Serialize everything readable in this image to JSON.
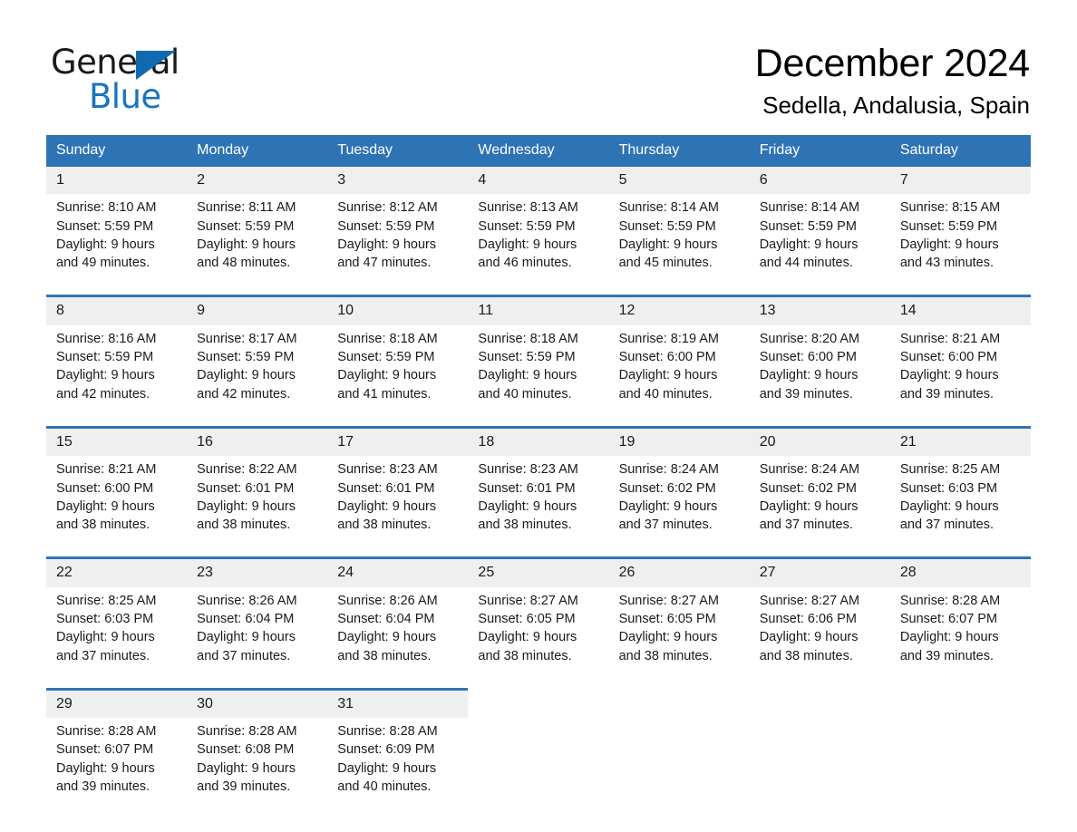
{
  "brand": {
    "name_part1": "General",
    "name_part2": "Blue",
    "triangle_color": "#1169b0",
    "blue_color": "#1a75bb"
  },
  "header": {
    "title": "December 2024",
    "location": "Sedella, Andalusia, Spain"
  },
  "theme": {
    "header_blue": "#2e74b5",
    "daynum_band": "#efefef",
    "text": "#1a1a1a"
  },
  "weekdays": [
    "Sunday",
    "Monday",
    "Tuesday",
    "Wednesday",
    "Thursday",
    "Friday",
    "Saturday"
  ],
  "weeks": [
    {
      "days": [
        {
          "date": "1",
          "sunrise": "Sunrise: 8:10 AM",
          "sunset": "Sunset: 5:59 PM",
          "daylight1": "Daylight: 9 hours",
          "daylight2": "and 49 minutes."
        },
        {
          "date": "2",
          "sunrise": "Sunrise: 8:11 AM",
          "sunset": "Sunset: 5:59 PM",
          "daylight1": "Daylight: 9 hours",
          "daylight2": "and 48 minutes."
        },
        {
          "date": "3",
          "sunrise": "Sunrise: 8:12 AM",
          "sunset": "Sunset: 5:59 PM",
          "daylight1": "Daylight: 9 hours",
          "daylight2": "and 47 minutes."
        },
        {
          "date": "4",
          "sunrise": "Sunrise: 8:13 AM",
          "sunset": "Sunset: 5:59 PM",
          "daylight1": "Daylight: 9 hours",
          "daylight2": "and 46 minutes."
        },
        {
          "date": "5",
          "sunrise": "Sunrise: 8:14 AM",
          "sunset": "Sunset: 5:59 PM",
          "daylight1": "Daylight: 9 hours",
          "daylight2": "and 45 minutes."
        },
        {
          "date": "6",
          "sunrise": "Sunrise: 8:14 AM",
          "sunset": "Sunset: 5:59 PM",
          "daylight1": "Daylight: 9 hours",
          "daylight2": "and 44 minutes."
        },
        {
          "date": "7",
          "sunrise": "Sunrise: 8:15 AM",
          "sunset": "Sunset: 5:59 PM",
          "daylight1": "Daylight: 9 hours",
          "daylight2": "and 43 minutes."
        }
      ]
    },
    {
      "days": [
        {
          "date": "8",
          "sunrise": "Sunrise: 8:16 AM",
          "sunset": "Sunset: 5:59 PM",
          "daylight1": "Daylight: 9 hours",
          "daylight2": "and 42 minutes."
        },
        {
          "date": "9",
          "sunrise": "Sunrise: 8:17 AM",
          "sunset": "Sunset: 5:59 PM",
          "daylight1": "Daylight: 9 hours",
          "daylight2": "and 42 minutes."
        },
        {
          "date": "10",
          "sunrise": "Sunrise: 8:18 AM",
          "sunset": "Sunset: 5:59 PM",
          "daylight1": "Daylight: 9 hours",
          "daylight2": "and 41 minutes."
        },
        {
          "date": "11",
          "sunrise": "Sunrise: 8:18 AM",
          "sunset": "Sunset: 5:59 PM",
          "daylight1": "Daylight: 9 hours",
          "daylight2": "and 40 minutes."
        },
        {
          "date": "12",
          "sunrise": "Sunrise: 8:19 AM",
          "sunset": "Sunset: 6:00 PM",
          "daylight1": "Daylight: 9 hours",
          "daylight2": "and 40 minutes."
        },
        {
          "date": "13",
          "sunrise": "Sunrise: 8:20 AM",
          "sunset": "Sunset: 6:00 PM",
          "daylight1": "Daylight: 9 hours",
          "daylight2": "and 39 minutes."
        },
        {
          "date": "14",
          "sunrise": "Sunrise: 8:21 AM",
          "sunset": "Sunset: 6:00 PM",
          "daylight1": "Daylight: 9 hours",
          "daylight2": "and 39 minutes."
        }
      ]
    },
    {
      "days": [
        {
          "date": "15",
          "sunrise": "Sunrise: 8:21 AM",
          "sunset": "Sunset: 6:00 PM",
          "daylight1": "Daylight: 9 hours",
          "daylight2": "and 38 minutes."
        },
        {
          "date": "16",
          "sunrise": "Sunrise: 8:22 AM",
          "sunset": "Sunset: 6:01 PM",
          "daylight1": "Daylight: 9 hours",
          "daylight2": "and 38 minutes."
        },
        {
          "date": "17",
          "sunrise": "Sunrise: 8:23 AM",
          "sunset": "Sunset: 6:01 PM",
          "daylight1": "Daylight: 9 hours",
          "daylight2": "and 38 minutes."
        },
        {
          "date": "18",
          "sunrise": "Sunrise: 8:23 AM",
          "sunset": "Sunset: 6:01 PM",
          "daylight1": "Daylight: 9 hours",
          "daylight2": "and 38 minutes."
        },
        {
          "date": "19",
          "sunrise": "Sunrise: 8:24 AM",
          "sunset": "Sunset: 6:02 PM",
          "daylight1": "Daylight: 9 hours",
          "daylight2": "and 37 minutes."
        },
        {
          "date": "20",
          "sunrise": "Sunrise: 8:24 AM",
          "sunset": "Sunset: 6:02 PM",
          "daylight1": "Daylight: 9 hours",
          "daylight2": "and 37 minutes."
        },
        {
          "date": "21",
          "sunrise": "Sunrise: 8:25 AM",
          "sunset": "Sunset: 6:03 PM",
          "daylight1": "Daylight: 9 hours",
          "daylight2": "and 37 minutes."
        }
      ]
    },
    {
      "days": [
        {
          "date": "22",
          "sunrise": "Sunrise: 8:25 AM",
          "sunset": "Sunset: 6:03 PM",
          "daylight1": "Daylight: 9 hours",
          "daylight2": "and 37 minutes."
        },
        {
          "date": "23",
          "sunrise": "Sunrise: 8:26 AM",
          "sunset": "Sunset: 6:04 PM",
          "daylight1": "Daylight: 9 hours",
          "daylight2": "and 37 minutes."
        },
        {
          "date": "24",
          "sunrise": "Sunrise: 8:26 AM",
          "sunset": "Sunset: 6:04 PM",
          "daylight1": "Daylight: 9 hours",
          "daylight2": "and 38 minutes."
        },
        {
          "date": "25",
          "sunrise": "Sunrise: 8:27 AM",
          "sunset": "Sunset: 6:05 PM",
          "daylight1": "Daylight: 9 hours",
          "daylight2": "and 38 minutes."
        },
        {
          "date": "26",
          "sunrise": "Sunrise: 8:27 AM",
          "sunset": "Sunset: 6:05 PM",
          "daylight1": "Daylight: 9 hours",
          "daylight2": "and 38 minutes."
        },
        {
          "date": "27",
          "sunrise": "Sunrise: 8:27 AM",
          "sunset": "Sunset: 6:06 PM",
          "daylight1": "Daylight: 9 hours",
          "daylight2": "and 38 minutes."
        },
        {
          "date": "28",
          "sunrise": "Sunrise: 8:28 AM",
          "sunset": "Sunset: 6:07 PM",
          "daylight1": "Daylight: 9 hours",
          "daylight2": "and 39 minutes."
        }
      ]
    },
    {
      "days": [
        {
          "date": "29",
          "sunrise": "Sunrise: 8:28 AM",
          "sunset": "Sunset: 6:07 PM",
          "daylight1": "Daylight: 9 hours",
          "daylight2": "and 39 minutes."
        },
        {
          "date": "30",
          "sunrise": "Sunrise: 8:28 AM",
          "sunset": "Sunset: 6:08 PM",
          "daylight1": "Daylight: 9 hours",
          "daylight2": "and 39 minutes."
        },
        {
          "date": "31",
          "sunrise": "Sunrise: 8:28 AM",
          "sunset": "Sunset: 6:09 PM",
          "daylight1": "Daylight: 9 hours",
          "daylight2": "and 40 minutes."
        },
        {
          "date": "",
          "sunrise": "",
          "sunset": "",
          "daylight1": "",
          "daylight2": ""
        },
        {
          "date": "",
          "sunrise": "",
          "sunset": "",
          "daylight1": "",
          "daylight2": ""
        },
        {
          "date": "",
          "sunrise": "",
          "sunset": "",
          "daylight1": "",
          "daylight2": ""
        },
        {
          "date": "",
          "sunrise": "",
          "sunset": "",
          "daylight1": "",
          "daylight2": ""
        }
      ]
    }
  ]
}
